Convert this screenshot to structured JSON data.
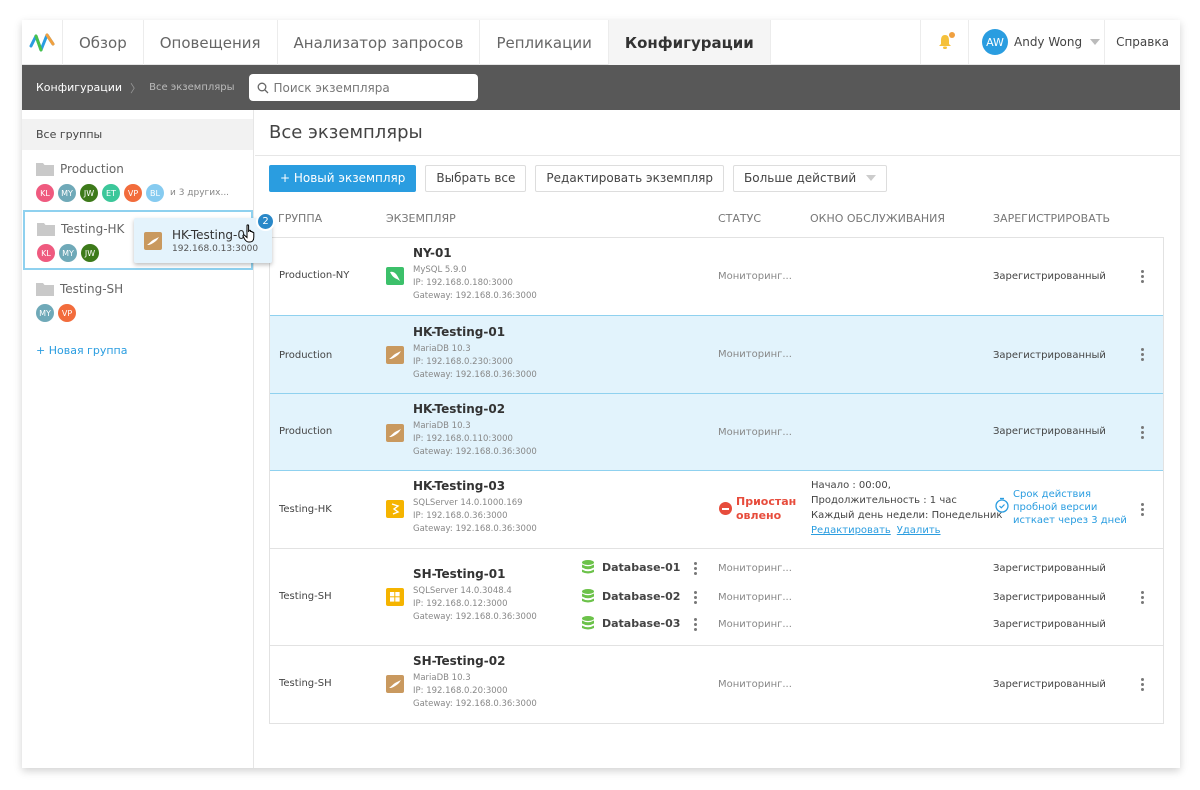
{
  "nav": {
    "tabs": [
      {
        "label": "Обзор"
      },
      {
        "label": "Оповещения"
      },
      {
        "label": "Анализатор запросов"
      },
      {
        "label": "Репликации"
      },
      {
        "label": "Конфигурации",
        "active": true
      }
    ],
    "user": {
      "initials": "AW",
      "name": "Andy Wong"
    },
    "help_label": "Справка",
    "notification_dot_color": "#f0a040"
  },
  "subbar": {
    "breadcrumb": [
      "Конфигурации",
      "Все экземпляры"
    ],
    "search_placeholder": "Поиск экземпляра"
  },
  "sidebar": {
    "all_groups_label": "Все группы",
    "groups": [
      {
        "name": "Production",
        "members": [
          "KL",
          "MY",
          "JW",
          "ET",
          "VP",
          "BL"
        ],
        "more": "и 3 других..."
      },
      {
        "name": "Testing-HK",
        "members": [
          "KL",
          "MY",
          "JW"
        ],
        "more": ""
      },
      {
        "name": "Testing-SH",
        "members": [
          "MY",
          "VP"
        ],
        "more": ""
      }
    ],
    "new_group_label": "+ Новая группа"
  },
  "drag_ghost": {
    "name": "HK-Testing-01",
    "ip": "192.168.0.13:3000",
    "count": "2"
  },
  "main": {
    "title": "Все экземпляры",
    "toolbar": {
      "new_instance": "+ Новый экземпляр",
      "select_all": "Выбрать все",
      "edit_instance": "Редактировать экземпляр",
      "more_actions": "Больше действий"
    },
    "columns": {
      "group": "ГРУППА",
      "instance": "ЭКЗЕМПЛЯР",
      "status": "СТАТУС",
      "maintenance": "ОКНО ОБСЛУЖИВАНИЯ",
      "register": "ЗАРЕГИСТРИРОВАТЬ"
    },
    "rows": [
      {
        "group": "Production-NY",
        "name": "NY-01",
        "db_type": "MySQL 5.9.0",
        "ip": "IP: 192.168.0.180:3000",
        "gateway": "Gateway: 192.168.0.36:3000",
        "status": "Мониторинг...",
        "register": "Зарегистрированный",
        "icon": "mysql-icon",
        "selected": false
      },
      {
        "group": "Production",
        "name": "HK-Testing-01",
        "db_type": "MariaDB 10.3",
        "ip": "IP: 192.168.0.230:3000",
        "gateway": "Gateway: 192.168.0.36:3000",
        "status": "Мониторинг...",
        "register": "Зарегистрированный",
        "icon": "mariadb-icon",
        "selected": true
      },
      {
        "group": "Production",
        "name": "HK-Testing-02",
        "db_type": "MariaDB 10.3",
        "ip": "IP: 192.168.0.110:3000",
        "gateway": "Gateway: 192.168.0.36:3000",
        "status": "Мониторинг...",
        "register": "Зарегистрированный",
        "icon": "mariadb-icon",
        "selected": true
      },
      {
        "group": "Testing-HK",
        "name": "HK-Testing-03",
        "db_type": "SQLServer 14.0.1000.169",
        "ip": "IP: 192.168.0.36:3000",
        "gateway": "Gateway: 192.168.0.36:3000",
        "status": "Приостан овлено",
        "status_line1": "Приостан",
        "status_line2": "овлено",
        "icon": "sqlserver-icon",
        "selected": false,
        "maintenance": {
          "start": "Начало : 00:00,",
          "duration": "Продолжительность : 1  час",
          "repeat": "Каждый день недели: Понедельник",
          "edit": "Редактировать",
          "delete": "Удалить"
        },
        "trial": [
          "Срок действия",
          "пробной версии",
          "исткает через 3 дней"
        ]
      },
      {
        "group": "Testing-SH",
        "name": "SH-Testing-01",
        "db_type": "SQLServer 14.0.3048.4",
        "ip": "IP: 192.168.0.12:3000",
        "gateway": "Gateway: 192.168.0.36:3000",
        "icon": "windows-icon",
        "selected": false,
        "databases": [
          {
            "name": "Database-01",
            "status": "Мониторинг...",
            "register": "Зарегистрированный"
          },
          {
            "name": "Database-02",
            "status": "Мониторинг...",
            "register": "Зарегистрированный"
          },
          {
            "name": "Database-03",
            "status": "Мониторинг...",
            "register": "Зарегистрированный"
          }
        ]
      },
      {
        "group": "Testing-SH",
        "name": "SH-Testing-02",
        "db_type": "MariaDB 10.3",
        "ip": "IP: 192.168.0.20:3000",
        "gateway": "Gateway: 192.168.0.36:3000",
        "status": "Мониторинг...",
        "register": "Зарегистрированный",
        "icon": "mariadb-icon",
        "selected": false
      }
    ]
  },
  "colors": {
    "accent": "#2a9de0",
    "selected_row": "#e2f3fc",
    "paused": "#e74c3c",
    "subbar": "#585858",
    "avatar_KL": "#ef5a7f",
    "avatar_MY": "#6fa9b8",
    "avatar_JW": "#3d7a1a",
    "avatar_ET": "#3cc79a",
    "avatar_VP": "#f26c3c",
    "avatar_BL": "#86cbf0"
  }
}
